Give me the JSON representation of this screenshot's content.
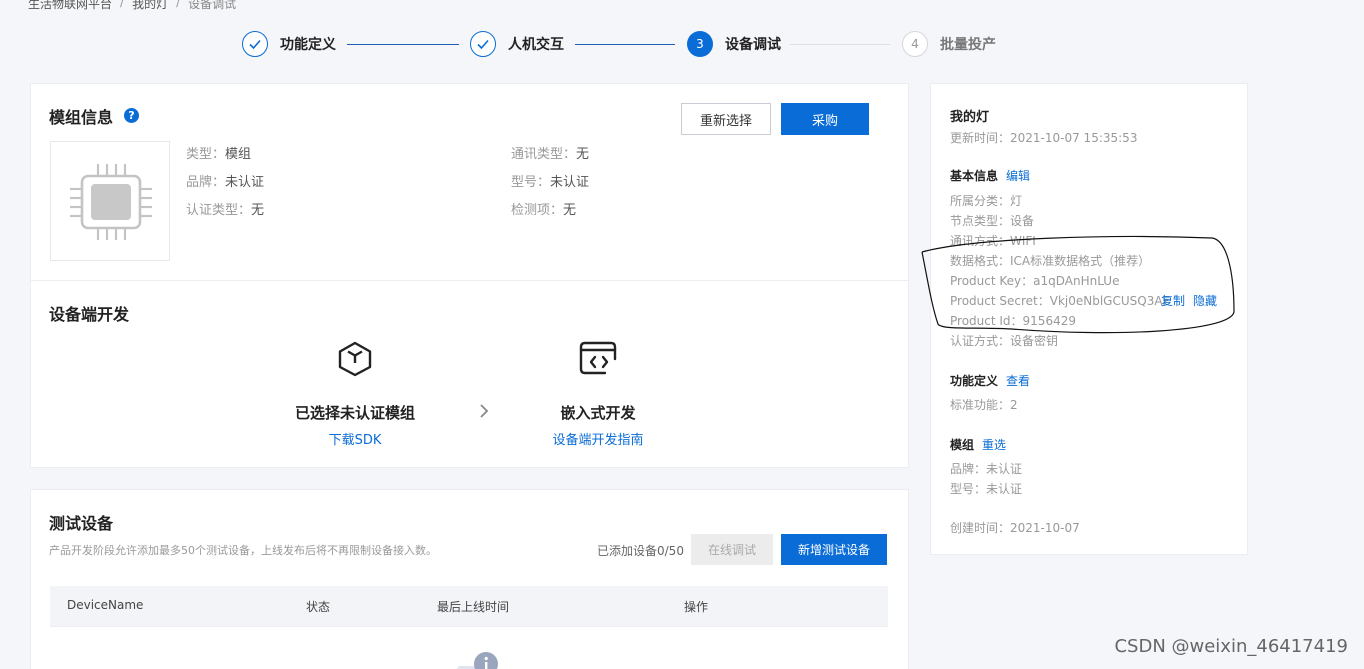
{
  "breadcrumb": [
    "生活物联网平台",
    "我的灯",
    "设备调试"
  ],
  "steps": [
    {
      "label": "功能定义",
      "state": "done"
    },
    {
      "label": "人机交互",
      "state": "done"
    },
    {
      "label": "设备调试",
      "state": "active",
      "num": "3"
    },
    {
      "label": "批量投产",
      "state": "todo",
      "num": "4"
    }
  ],
  "module": {
    "title": "模组信息",
    "help": "?",
    "reselect_label": "重新选择",
    "purchase_label": "采购",
    "left_info": [
      {
        "key": "类型：",
        "value": "模组"
      },
      {
        "key": "品牌：",
        "value": "未认证"
      },
      {
        "key": "认证类型：",
        "value": "无"
      }
    ],
    "right_info": [
      {
        "key": "通讯类型：",
        "value": "无"
      },
      {
        "key": "型号：",
        "value": "未认证"
      },
      {
        "key": "检测项：",
        "value": "无"
      }
    ]
  },
  "device_dev": {
    "title": "设备端开发",
    "left": {
      "title": "已选择未认证模组",
      "link": "下载SDK"
    },
    "right": {
      "title": "嵌入式开发",
      "link": "设备端开发指南"
    }
  },
  "test": {
    "title": "测试设备",
    "desc": "产品开发阶段允许添加最多50个测试设备，上线发布后将不再限制设备接入数。",
    "count": "已添加设备0/50",
    "online_debug_label": "在线调试",
    "add_label": "新增测试设备",
    "columns": [
      "DeviceName",
      "状态",
      "最后上线时间",
      "操作"
    ]
  },
  "product": {
    "name": "我的灯",
    "updated": "更新时间：2021-10-07 15:35:53",
    "basic_title": "基本信息",
    "edit_label": "编辑",
    "basic": [
      "所属分类：灯",
      "节点类型：设备",
      "通讯方式：WIFI",
      "数据格式：ICA标准数据格式（推荐）",
      "Product Key：a1qDAnHnLUe",
      "Product Secret：Vkj0eNblGCUSQ3AF",
      "Product Id：9156429",
      "认证方式：设备密钥"
    ],
    "copy_label": "复制",
    "hide_label": "隐藏",
    "func_title": "功能定义",
    "view_label": "查看",
    "func_count": "标准功能：2",
    "module_title": "模组",
    "reselect_label": "重选",
    "module_info": [
      "品牌：未认证",
      "型号：未认证"
    ],
    "created": "创建时间：2021-10-07"
  },
  "watermark": "CSDN @weixin_46417419"
}
